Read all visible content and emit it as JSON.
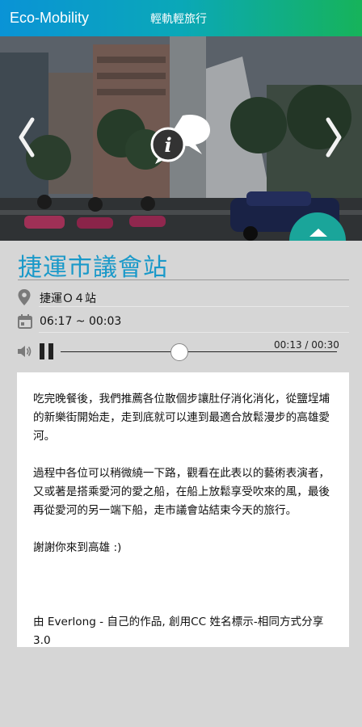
{
  "header": {
    "brand": "Eco-Mobility",
    "subtitle": "輕軌輕旅行"
  },
  "hero": {
    "prev_icon": "chevron-left-icon",
    "next_icon": "chevron-right-icon",
    "info_icon": "info-chat-icon",
    "up_icon": "chevron-up-icon"
  },
  "station": {
    "title": "捷運市議會站",
    "code": "捷運Ｏ４站",
    "hours": "06:17 ~ 00:03"
  },
  "player": {
    "time": "00:13 / 00:30",
    "progress": 0.43
  },
  "description": {
    "para1": "吃完晚餐後，我們推薦各位散個步讓肚仔消化消化，從鹽埕埔的新樂街開始走，走到底就可以連到最適合放鬆漫步的高雄愛河。",
    "para2": "過程中各位可以稍微繞一下路，觀看在此表以的藝術表演者，又或著是搭乘愛河的愛之船，在船上放鬆享受吹來的風，最後再從愛河的另一端下船，走市議會站結束今天的旅行。",
    "para3": "謝謝你來到高雄 :)",
    "credit": "由 Everlong - 自己的作品, 創用CC 姓名標示-相同方式分享 3.0"
  },
  "colors": {
    "title": "#1a99c9",
    "header_start": "#0a93d6",
    "header_end": "#16b35a",
    "up_button": "#1aa59a"
  }
}
